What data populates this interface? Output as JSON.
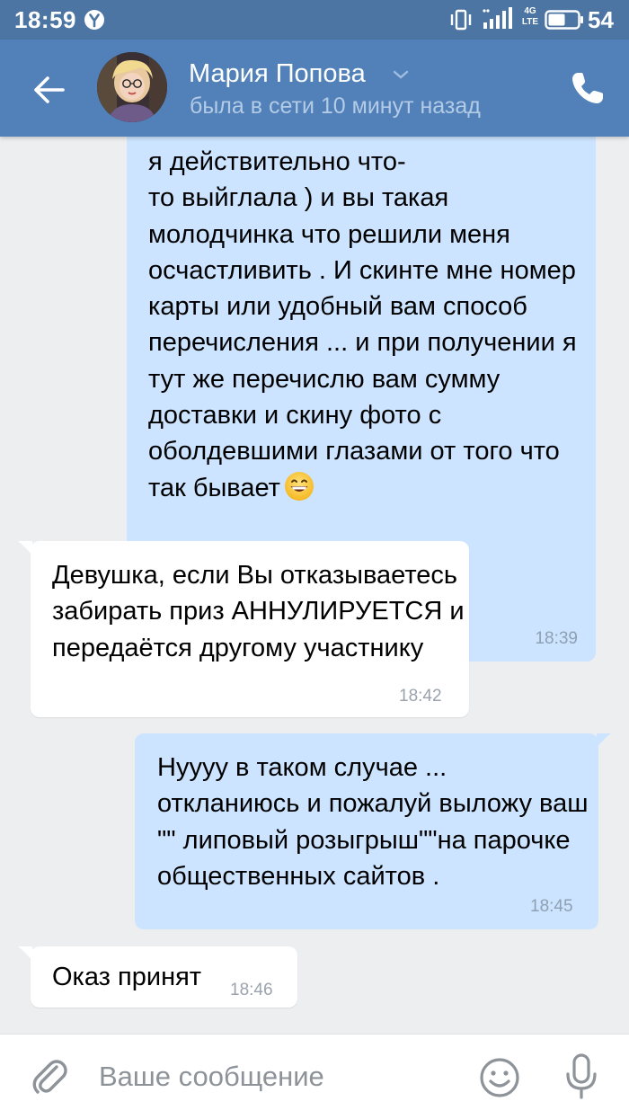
{
  "status_bar": {
    "time": "18:59",
    "network_line1": "4G",
    "network_line2": "LTE",
    "battery_level": "54"
  },
  "header": {
    "contact_name": "Мария Попова",
    "contact_status": "была в сети 10 минут назад"
  },
  "messages": [
    {
      "direction": "out",
      "text": "я действительно что-\nто выйглала ) и вы такая молодчинка что решили меня осчастливить . И скинте мне номер карты или удобный вам способ перечисления ... и при получении я тут же перечислю вам сумму доставки и скину фото с оболдевшими глазами от того что так бывает",
      "time": "18:39",
      "emoji": "grinning-face"
    },
    {
      "direction": "in",
      "text": "Девушка, если Вы отказываетесь забирать приз АННУЛИРУЕТСЯ и передаётся другому участнику",
      "time": "18:42"
    },
    {
      "direction": "out",
      "text": "Нуууу в таком случае ...\nоткланиюсь  и пожалуй выложу ваш \"\" липовый розыгрыш\"\"на парочке общественных сайтов .",
      "time": "18:45"
    },
    {
      "direction": "in",
      "text": "Оказ принят",
      "time": "18:46"
    }
  ],
  "input": {
    "placeholder": "Ваше сообщение",
    "value": ""
  },
  "colors": {
    "header": "#5181b8",
    "status_bar": "#4c75a3",
    "background": "#edeef0",
    "outgoing_bubble": "#cce4ff",
    "incoming_bubble": "#ffffff"
  },
  "icons": [
    "arrow-left-icon",
    "chevron-down-icon",
    "phone-icon",
    "paperclip-icon",
    "smiley-icon",
    "microphone-icon",
    "yandex-icon",
    "vibrate-icon",
    "signal-icon",
    "battery-icon"
  ]
}
